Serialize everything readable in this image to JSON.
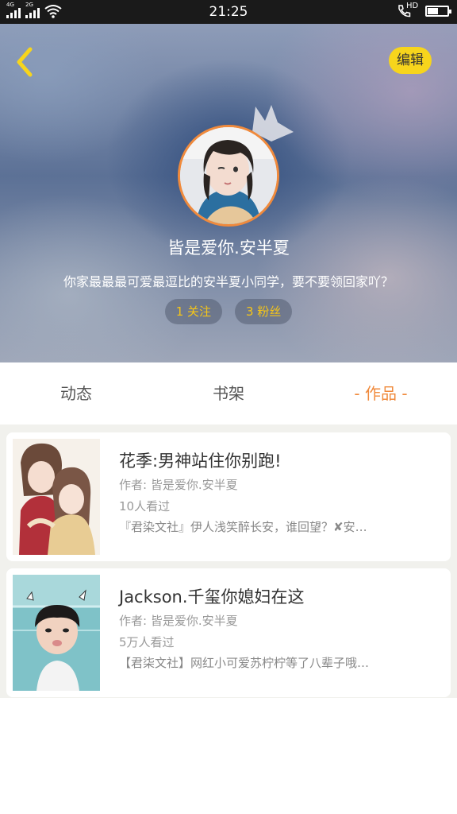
{
  "status_bar": {
    "time": "21:25",
    "network_1": "4G",
    "network_2": "2G",
    "hd_label": "HD",
    "battery_level": 0.55
  },
  "header": {
    "edit_label": "编辑",
    "username": "皆是爱你.安半夏",
    "bio": "你家最最最可爱最逗比的安半夏小同学，要不要领回家吖？",
    "following_label": "1 关注",
    "followers_label": "3 粉丝"
  },
  "tabs": [
    {
      "label": "动态",
      "active": false
    },
    {
      "label": "书架",
      "active": false
    },
    {
      "label": "- 作品 -",
      "active": true
    }
  ],
  "works": [
    {
      "title": "花季:男神站住你别跑!",
      "author": "作者: 皆是爱你.安半夏",
      "views": "10人看过",
      "description": "『君染文社』伊人浅笑醉长安，谁回望？✘安…"
    },
    {
      "title": "Jackson.千玺你媳妇在这",
      "author": "作者: 皆是爱你.安半夏",
      "views": "5万人看过",
      "description": "【君柒文社】网红小可爱苏柠柠等了八辈子哦…"
    }
  ],
  "colors": {
    "accent": "#f08a3c",
    "edit_button": "#f7d51c",
    "stat_text": "#f5c518"
  }
}
